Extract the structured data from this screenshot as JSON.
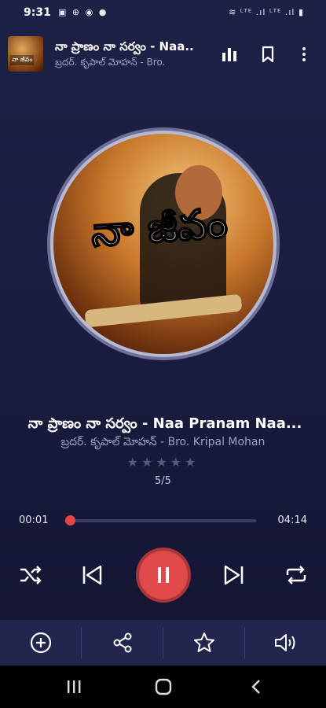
{
  "status_bar": {
    "time": "9:31",
    "left_icons": "▣ ⊕ ◉ ●",
    "right_icons": "≋ ᴸᵀᴱ .ıl ᴸᵀᴱ .ıl ▮"
  },
  "header": {
    "thumb_text": "నా జీవం",
    "title": "నా ప్రాణం నా సర్వం - Naa..",
    "artist": "బ్రదర్. కృపాల్ మోహన్ - Bro."
  },
  "artwork": {
    "text": "నా జీవం"
  },
  "song": {
    "title": "నా ప్రాణం నా సర్వం - Naa Pranam Naa...",
    "artist": "బ్రదర్. కృపాల్ మోహన్ - Bro. Kripal Mohan",
    "stars": "★★★★★",
    "rating": 0,
    "track_position": "5/5"
  },
  "progress": {
    "elapsed": "00:01",
    "total": "04:14",
    "fraction": 0.004
  },
  "colors": {
    "accent": "#e14a4a",
    "background": "#1d2146",
    "bottom_bar": "#22264f"
  },
  "icons": {
    "equalizer": "equalizer-icon",
    "bookmark": "bookmark-icon",
    "more": "more-vertical-icon",
    "shuffle": "shuffle-icon",
    "previous": "skip-previous-icon",
    "pause": "pause-icon",
    "next": "skip-next-icon",
    "repeat": "repeat-icon",
    "add": "add-circle-icon",
    "share": "share-icon",
    "favorite": "star-icon",
    "volume": "volume-icon"
  }
}
